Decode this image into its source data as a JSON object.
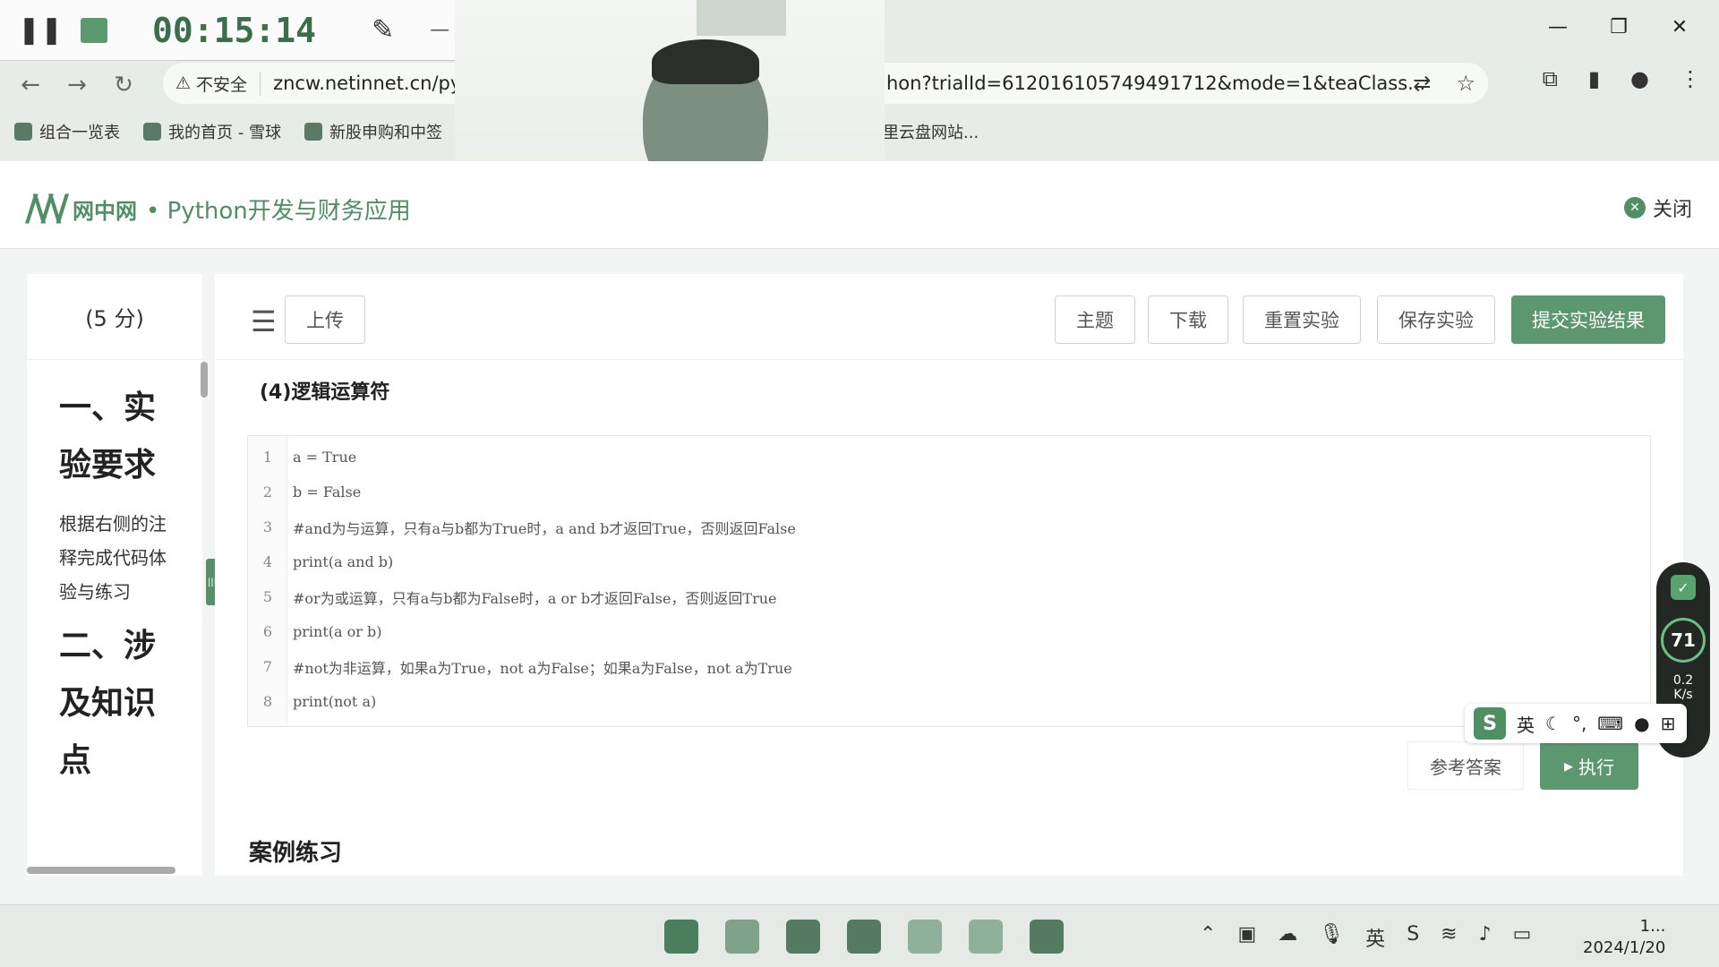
{
  "recorder": {
    "time": "00:15:14"
  },
  "browser": {
    "security_label": "不安全",
    "url_start": "zncw.netinnet.cn/pyt",
    "url_end": "hon?trialId=612016105749491712&mode=1&teaClass...",
    "bookmarks": [
      "组合一览表",
      "我的首页 - 雪球",
      "新股申购和中签"
    ],
    "bookmark_cut": "里云盘网站..."
  },
  "header": {
    "brand": "网中网",
    "course": "• Python开发与财务应用",
    "close_label": "关闭"
  },
  "sidebar": {
    "score": "(5 分)",
    "heading1": "一、实验要求",
    "paragraph": "根据右侧的注释完成代码体验与练习",
    "heading2": "二、涉及知识点"
  },
  "toolbar": {
    "upload": "上传",
    "theme": "主题",
    "download": "下载",
    "reset": "重置实验",
    "save": "保存实验",
    "submit": "提交实验结果"
  },
  "section_title": "(4)逻辑运算符",
  "code": {
    "line_numbers": [
      "1",
      "2",
      "3",
      "4",
      "5",
      "6",
      "7",
      "8"
    ],
    "lines": [
      "a = True",
      "b = False",
      "#and为与运算，只有a与b都为True时，a and b才返回True，否则返回False",
      "print(a and b)",
      "#or为或运算，只有a与b都为False时，a or b才返回False，否则返回True",
      "print(a or b)",
      "#not为非运算，如果a为True，not a为False；如果a为False，not a为True",
      "print(not a)"
    ]
  },
  "buttons": {
    "reference": "参考答案",
    "run": "执行"
  },
  "case_title": "案例练习",
  "monitor": {
    "percent": "71",
    "speed_up": "0.2",
    "speed_unit": "K/s"
  },
  "ime": {
    "mode": "英"
  },
  "taskbar": {
    "date": "2024/1/20",
    "time": "1..."
  },
  "colors": {
    "accent": "#5d9770"
  }
}
